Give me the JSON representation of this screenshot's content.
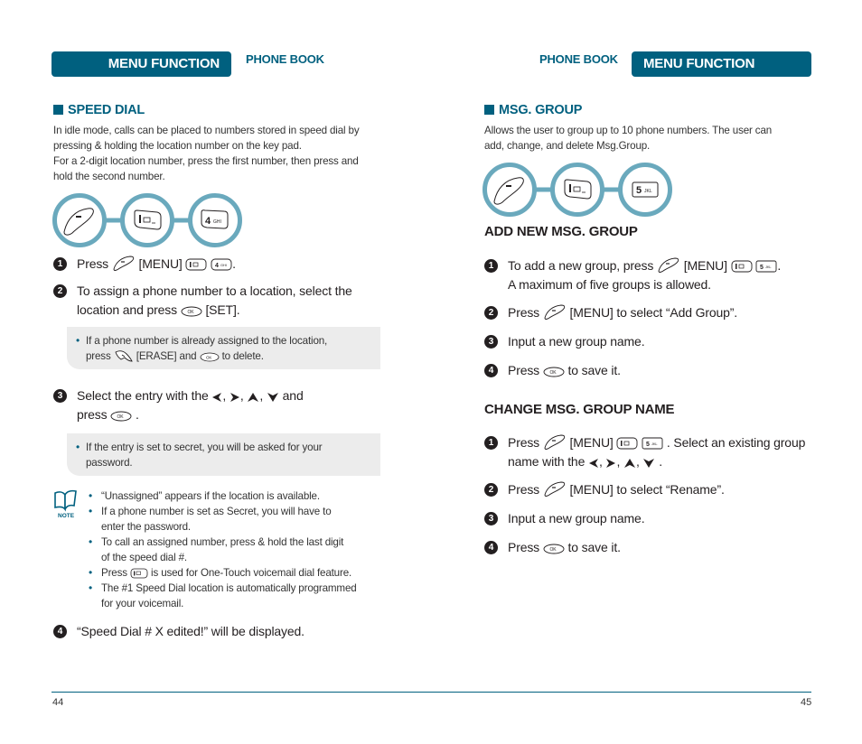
{
  "left_page": {
    "header_bar": "MENU FUNCTION",
    "header_section": "PHONE BOOK",
    "section_title": "SPEED DIAL",
    "intro": [
      "In idle mode, calls can be placed to numbers stored in speed dial by",
      "pressing & holding the location number on the key pad.",
      "For a 2-digit location number, press the first number, then press and",
      "hold the second number."
    ],
    "key_sequence": [
      "menu-soft-key",
      "key-1",
      "key-4"
    ],
    "key_labels": {
      "k1": "1",
      "k4": "4",
      "k4_sub": "GHI"
    },
    "steps": {
      "s1": {
        "num": "1",
        "press": "Press",
        "menu": "[MENU]",
        "end": "."
      },
      "s2": {
        "num": "2",
        "line1": "To assign a phone number to a location, select the",
        "line2a": "location and press",
        "line2b": "[SET]."
      },
      "s3": {
        "num": "3",
        "a": "Select the entry with the",
        "sep": ",",
        "b": "and",
        "c": "press",
        "end": "."
      },
      "s4": {
        "num": "4",
        "text": "“Speed Dial # X edited!” will be displayed."
      }
    },
    "info_box_1": {
      "line1": "If a phone number is already assigned to the location,",
      "a": "press",
      "b": "[ERASE] and",
      "c": "to delete."
    },
    "info_box_2": {
      "line1": "If the entry is set to secret, you will be asked for your",
      "line2": "password."
    },
    "note_label": "NOTE",
    "notes": {
      "n1": "“Unassigned” appears if the location is available.",
      "n2a": "If a phone number is set as Secret, you will have to",
      "n2b": "enter the password.",
      "n3a": "To call an assigned number, press & hold the last digit",
      "n3b": "of the speed dial #.",
      "n4a": "Press",
      "n4b": "is used for One-Touch voicemail dial feature.",
      "n5a": "The #1 Speed Dial location is automatically programmed",
      "n5b": "for your voicemail."
    },
    "page_number": "44"
  },
  "right_page": {
    "header_bar": "MENU FUNCTION",
    "header_section": "PHONE BOOK",
    "section_title": "MSG. GROUP",
    "intro": [
      "Allows the user to group up to 10 phone numbers. The user can",
      "add, change, and delete Msg.Group."
    ],
    "key_sequence": [
      "menu-soft-key",
      "key-1",
      "key-5"
    ],
    "key_labels": {
      "k1": "1",
      "k5": "5",
      "k5_sub": "JKL"
    },
    "add_group": {
      "heading": "ADD NEW MSG. GROUP",
      "s1": {
        "num": "1",
        "a": "To add a new group, press",
        "menu": "[MENU]",
        "end": ".",
        "line2": "A maximum of five groups is allowed."
      },
      "s2": {
        "num": "2",
        "a": "Press",
        "b": "[MENU] to select “Add Group”."
      },
      "s3": {
        "num": "3",
        "text": "Input a new group name."
      },
      "s4": {
        "num": "4",
        "a": "Press",
        "b": "to save it."
      }
    },
    "change_group": {
      "heading": "CHANGE MSG. GROUP NAME",
      "s1": {
        "num": "1",
        "a": "Press",
        "menu": "[MENU]",
        "b": ". Select an existing group",
        "c": "name with the",
        "sep": ",",
        "end": "."
      },
      "s2": {
        "num": "2",
        "a": "Press",
        "b": "[MENU] to select “Rename”."
      },
      "s3": {
        "num": "3",
        "text": "Input a new group name."
      },
      "s4": {
        "num": "4",
        "a": "Press",
        "b": "to save it."
      }
    },
    "page_number": "45"
  },
  "colors": {
    "accent": "#00607f",
    "key_ring": "#6aa9bd",
    "info_bg": "#ececec"
  }
}
